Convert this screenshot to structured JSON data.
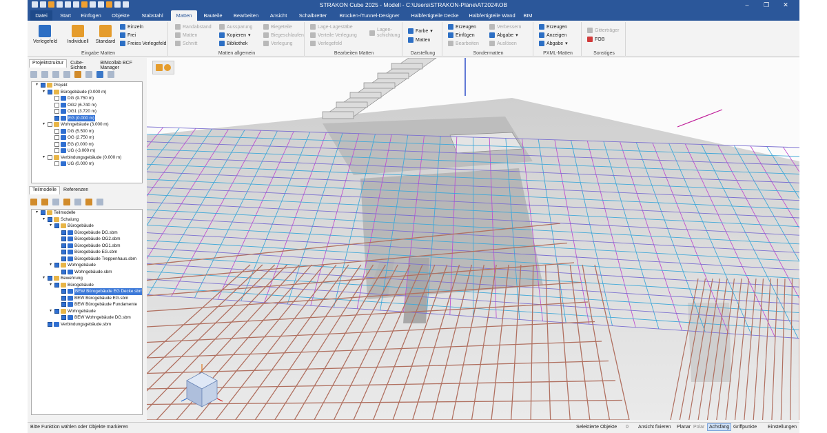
{
  "title_bar": {
    "title": "STRAKON Cube 2025 - Modell - C:\\Users\\STRAKON-Pläne\\AT2024\\OB"
  },
  "ribbon_tabs": [
    "Datei",
    "Start",
    "Einfügen",
    "Objekte",
    "Stabstahl",
    "Matten",
    "Bauteile",
    "Bearbeiten",
    "Ansicht",
    "Schalbretter",
    "Brücken-/Tunnel-Designer",
    "Halbfertigteile Decke",
    "Halbfertigteile Wand",
    "BIM"
  ],
  "ribbon": {
    "eingabe": {
      "label": "Eingabe Matten",
      "verlegefeld": "Verlegefeld",
      "individuell": "Individuell",
      "standard": "Standard",
      "einzeln": "Einzeln",
      "frei": "Frei",
      "freies_verlegefeld": "Freies Verlegefeld"
    },
    "allgemein": {
      "label": "Matten allgemein",
      "randabstand": "Randabstand",
      "matten": "Matten",
      "schnitt": "Schnitt",
      "aussparung": "Aussparung",
      "kopieren": "Kopieren",
      "bibliothek": "Bibliothek",
      "biegeteile": "Biegeteile",
      "biegeschlaufen": "Biegeschlaufen",
      "verlegung": "Verlegung"
    },
    "bearbeiten": {
      "label": "Bearbeiten Matten",
      "lage": "Lage-Lagestäbe",
      "verteile": "Verteile Verlegung",
      "verlegefeld": "Verlegefeld",
      "lagen": "Lagen-",
      "schichtung": "schichtung"
    },
    "darstellung": {
      "label": "Darstellung",
      "farbe": "Farbe",
      "matten": "Matten"
    },
    "sondermatten": {
      "label": "Sondermatten",
      "erzeugen": "Erzeugen",
      "einfuegen": "Einfügen",
      "bearbeiten": "Bearbeiten",
      "verbessern": "Verbessern",
      "abgabe": "Abgabe",
      "ausloesen": "Auslösen"
    },
    "pxml": {
      "label": "PXML-Matten",
      "erzeugen": "Erzeugen",
      "anzeigen": "Anzeigen",
      "abgabe": "Abgabe"
    },
    "sonstiges": {
      "label": "Sonstiges",
      "gittertraeger": "Gitterträger",
      "fob": "FOB"
    }
  },
  "project_panel": {
    "tabs": [
      "Projektstruktur",
      "Cube-Sichten",
      "BIMcollab BCF Manager"
    ],
    "tree": [
      {
        "label": "Projekt",
        "level": 0,
        "checked": true,
        "expander": "▾"
      },
      {
        "label": "Bürogebäude (0.000 m)",
        "level": 1,
        "checked": true,
        "expander": "▾"
      },
      {
        "label": "DG (9.750 m)",
        "level": 2,
        "checked": false
      },
      {
        "label": "OG2 (6.740 m)",
        "level": 2,
        "checked": false
      },
      {
        "label": "OG1 (3.720 m)",
        "level": 2,
        "checked": false
      },
      {
        "label": "EG (0.000 m)",
        "level": 2,
        "checked": true,
        "selected": true
      },
      {
        "label": "Wohngebäude (3.000 m)",
        "level": 1,
        "checked": false,
        "expander": "▾"
      },
      {
        "label": "DG (5.500 m)",
        "level": 2,
        "checked": false
      },
      {
        "label": "OG (2.750 m)",
        "level": 2,
        "checked": false
      },
      {
        "label": "EG (0.000 m)",
        "level": 2,
        "checked": false
      },
      {
        "label": "UG (-3.000 m)",
        "level": 2,
        "checked": false
      },
      {
        "label": "Verbindungsgebäude (0.000 m)",
        "level": 1,
        "checked": false,
        "expander": "▾"
      },
      {
        "label": "UG (0.000 m)",
        "level": 2,
        "checked": false
      }
    ]
  },
  "models_panel": {
    "tabs": [
      "Teilmodelle",
      "Referenzen"
    ],
    "tree": [
      {
        "label": "Teilmodelle",
        "level": 0,
        "checked": true,
        "expander": "▾"
      },
      {
        "label": "Schalung",
        "level": 1,
        "checked": true,
        "expander": "▾"
      },
      {
        "label": "Bürogebäude",
        "level": 2,
        "checked": true,
        "expander": "▾"
      },
      {
        "label": "Bürogebäude DG.sbm",
        "level": 3,
        "checked": true
      },
      {
        "label": "Bürogebäude OG2.sbm",
        "level": 3,
        "checked": true
      },
      {
        "label": "Bürogebäude OG1.sbm",
        "level": 3,
        "checked": true
      },
      {
        "label": "Bürogebäude EG.sbm",
        "level": 3,
        "checked": true
      },
      {
        "label": "Bürogebäude Treppenhaus.sbm",
        "level": 3,
        "checked": true
      },
      {
        "label": "Wohngebäude",
        "level": 2,
        "checked": true,
        "expander": "▾"
      },
      {
        "label": "Wohngebäude.sbm",
        "level": 3,
        "checked": true
      },
      {
        "label": "Bewehrung",
        "level": 1,
        "checked": true,
        "expander": "▾"
      },
      {
        "label": "Bürogebäude",
        "level": 2,
        "checked": true,
        "expander": "▾"
      },
      {
        "label": "BEW Bürogebäude EG Decke.sbm",
        "level": 3,
        "checked": true,
        "selected": true
      },
      {
        "label": "BEW Bürogebäude EG.sbm",
        "level": 3,
        "checked": true
      },
      {
        "label": "BEW Bürogebäude Fundamente",
        "level": 3,
        "checked": true
      },
      {
        "label": "Wohngebäude",
        "level": 2,
        "checked": true,
        "expander": "▾"
      },
      {
        "label": "BEW Wohngebäude DG.sbm",
        "level": 3,
        "checked": true
      },
      {
        "label": "Verbindungsgebäude.sbm",
        "level": 1,
        "checked": true
      }
    ]
  },
  "status_bar": {
    "message": "Bitte Funktion wählen oder Objekte markieren",
    "selected_label": "Selektierte Objekte",
    "selected_count": "0",
    "ansicht_fixieren": "Ansicht fixieren",
    "planar": "Planar",
    "polar": "Polar",
    "achsfang": "Achsfang",
    "griffpunkte": "Griffpunkte",
    "einstellungen": "Einstellungen"
  },
  "colors": {
    "accent": "#2b579a",
    "rebar_mesh_magenta": "#c050d0",
    "rebar_mesh_cyan": "#40a8d8",
    "rebar_bars": "#b07060"
  }
}
